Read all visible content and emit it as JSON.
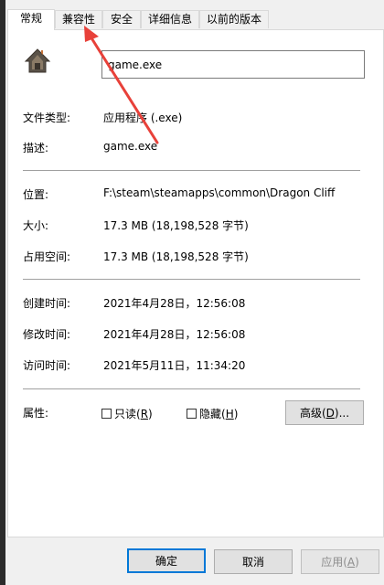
{
  "tabs": [
    {
      "label": "常规"
    },
    {
      "label": "兼容性"
    },
    {
      "label": "安全"
    },
    {
      "label": "详细信息"
    },
    {
      "label": "以前的版本"
    }
  ],
  "file_name": "game.exe",
  "file_type": {
    "label": "文件类型:",
    "value": "应用程序 (.exe)"
  },
  "description": {
    "label": "描述:",
    "value": "game.exe"
  },
  "location": {
    "label": "位置:",
    "value": "F:\\steam\\steamapps\\common\\Dragon Cliff"
  },
  "size": {
    "label": "大小:",
    "value": "17.3 MB (18,198,528 字节)"
  },
  "size_on_disk": {
    "label": "占用空间:",
    "value": "17.3 MB (18,198,528 字节)"
  },
  "created": {
    "label": "创建时间:",
    "value": "2021年4月28日，12:56:08"
  },
  "modified": {
    "label": "修改时间:",
    "value": "2021年4月28日，12:56:08"
  },
  "accessed": {
    "label": "访问时间:",
    "value": "2021年5月11日，11:34:20"
  },
  "attributes": {
    "label": "属性:",
    "readonly": {
      "text": "只读(",
      "key": "R",
      "end": ")"
    },
    "hidden": {
      "text": "隐藏(",
      "key": "H",
      "end": ")"
    },
    "advanced": {
      "text": "高级(",
      "key": "D",
      "end": ")..."
    }
  },
  "buttons": {
    "ok": "确定",
    "cancel": "取消",
    "apply_text": "应用(",
    "apply_key": "A",
    "apply_end": ")"
  },
  "colors": {
    "annotation_arrow": "#e8413a",
    "primary_focus": "#0078d7"
  }
}
